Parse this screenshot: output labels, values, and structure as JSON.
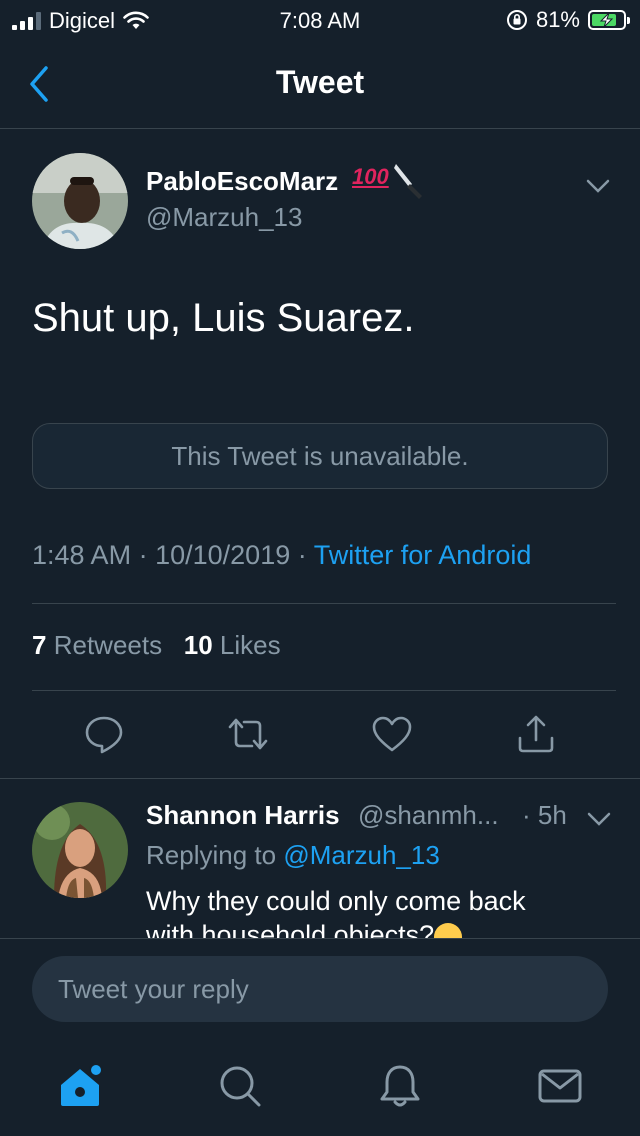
{
  "status_bar": {
    "carrier": "Digicel",
    "time": "7:08 AM",
    "battery": "81%",
    "battery_level": 0.81
  },
  "header": {
    "title": "Tweet"
  },
  "tweet": {
    "author_name": "PabloEscoMarz",
    "author_emoji_text": "100",
    "author_handle": "@Marzuh_13",
    "text": "Shut up, Luis Suarez.",
    "quoted_unavailable": "This Tweet is unavailable.",
    "time": "1:48 AM",
    "date": "10/10/2019",
    "meta_sep": "·",
    "source": "Twitter for Android",
    "retweets_count": "7",
    "retweets_label": "Retweets",
    "likes_count": "10",
    "likes_label": "Likes"
  },
  "actions": [
    "reply-icon",
    "retweet-icon",
    "like-icon",
    "share-icon"
  ],
  "reply": {
    "author_name": "Shannon Harris",
    "author_handle": "@shanmh...",
    "time": "· 5h",
    "replying_prefix": "Replying to",
    "replying_to": "@Marzuh_13",
    "text_line1": "Why they could only come back",
    "text_line2": "with household objects?"
  },
  "compose": {
    "placeholder": "Tweet your reply"
  },
  "tabbar": [
    "home-icon",
    "search-icon",
    "notifications-icon",
    "messages-icon"
  ],
  "colors": {
    "background": "#15202b",
    "accent": "#1da1f2",
    "secondary_text": "#8899a6",
    "divider": "#38444d"
  }
}
